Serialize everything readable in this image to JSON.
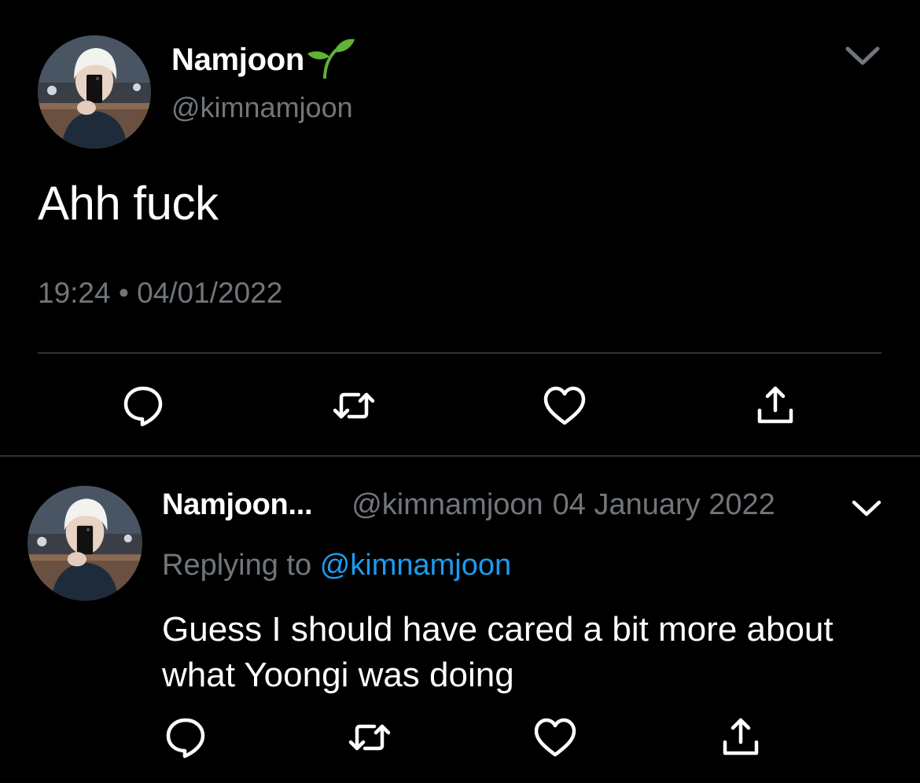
{
  "main_tweet": {
    "display_name": "Namjoon",
    "name_emoji": "seedling-icon",
    "handle": "@kimnamjoon",
    "text": "Ahh fuck",
    "time": "19:24",
    "separator": "•",
    "date": "04/01/2022",
    "actions": [
      "reply-icon",
      "retweet-icon",
      "like-icon",
      "share-icon"
    ]
  },
  "reply_tweet": {
    "display_name": "Namjoon...",
    "handle": "@kimnamjoon",
    "date": "04 January 2022",
    "replying_prefix": "Replying to",
    "replying_handle": "@kimnamjoon",
    "text": "Guess I should have cared a bit more about what Yoongi was doing",
    "actions": [
      "reply-icon",
      "retweet-icon",
      "like-icon",
      "share-icon"
    ]
  },
  "colors": {
    "background": "#000000",
    "text_primary": "#ffffff",
    "text_secondary": "#71767b",
    "link": "#1d9bf0",
    "divider": "#2f3336",
    "emoji_green": "#5fb336"
  }
}
